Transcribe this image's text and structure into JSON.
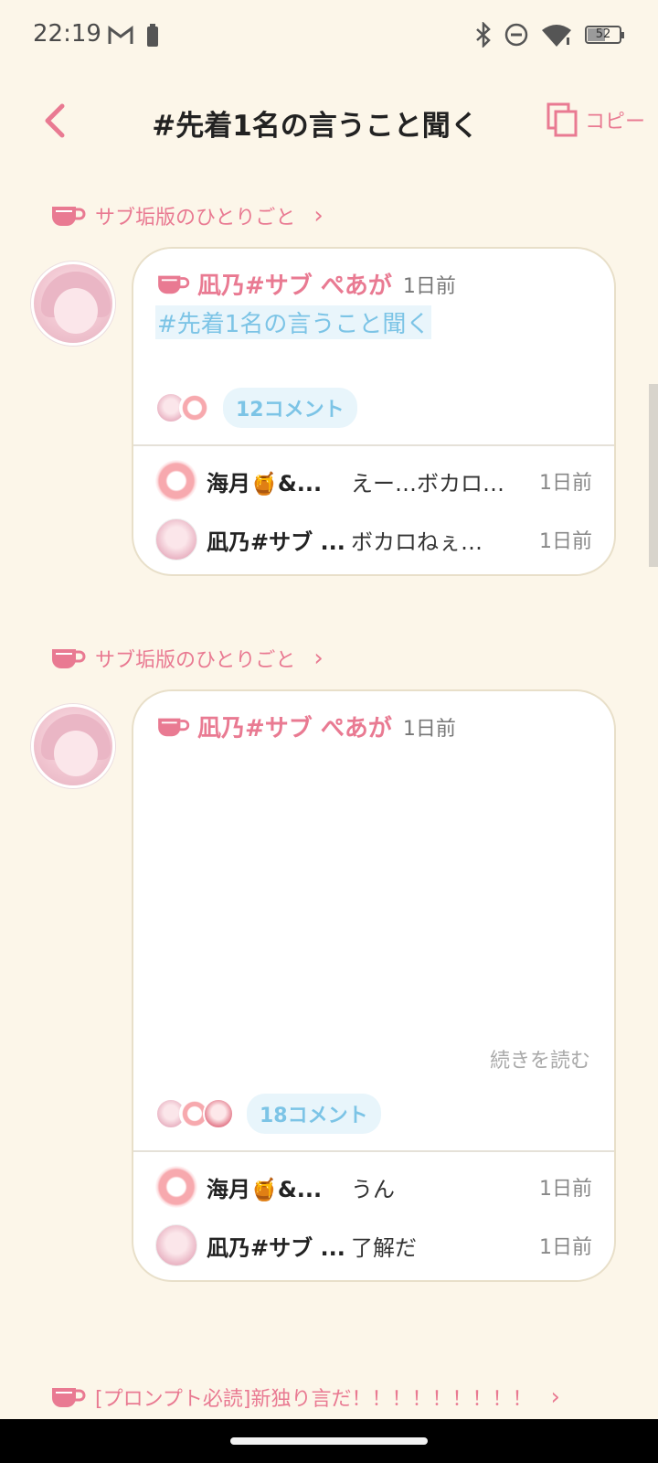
{
  "status": {
    "time": "22:19",
    "battery": "52",
    "battery_level": 0.52
  },
  "header": {
    "title": "#先着1名の言うこと聞く",
    "copy_label": "コピー"
  },
  "posts": [
    {
      "thread": "サブ垢版のひとりごと",
      "author": "凪乃#サブ ぺあが",
      "ago": "1日前",
      "hashtag": "#先着1名の言うこと聞く",
      "comment_count": "12コメント",
      "replies": [
        {
          "name": "海月🍯&...",
          "text": "えー…ボカロ…",
          "time": "1日前"
        },
        {
          "name": "凪乃#サブ ...",
          "text": "ボカロねぇ…",
          "time": "1日前"
        }
      ]
    },
    {
      "thread": "サブ垢版のひとりごと",
      "author": "凪乃#サブ ぺあが",
      "ago": "1日前",
      "read_more": "続きを読む",
      "comment_count": "18コメント",
      "replies": [
        {
          "name": "海月🍯&...",
          "text": "うん",
          "time": "1日前"
        },
        {
          "name": "凪乃#サブ ...",
          "text": "了解だ",
          "time": "1日前"
        }
      ]
    }
  ],
  "next_thread": "[プロンプト必読]新独り言だ！！！！！！！！！"
}
